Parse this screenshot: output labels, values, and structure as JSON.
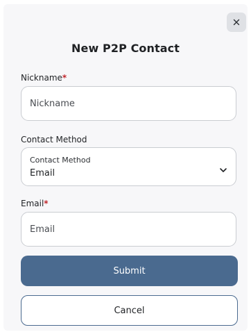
{
  "dialog": {
    "title": "New P2P Contact",
    "close_icon": "close-icon"
  },
  "form": {
    "nickname": {
      "label": "Nickname",
      "required_mark": "*",
      "placeholder": "Nickname",
      "value": ""
    },
    "contact_method": {
      "label": "Contact Method",
      "inner_label": "Contact Method",
      "selected": "Email",
      "icon": "chevron-down-icon"
    },
    "email": {
      "label": "Email",
      "required_mark": "*",
      "placeholder": "Email",
      "value": ""
    }
  },
  "actions": {
    "submit_label": "Submit",
    "cancel_label": "Cancel"
  },
  "colors": {
    "primary": "#4a6a8f",
    "required": "#c0282d",
    "background": "#f7f7f9"
  }
}
